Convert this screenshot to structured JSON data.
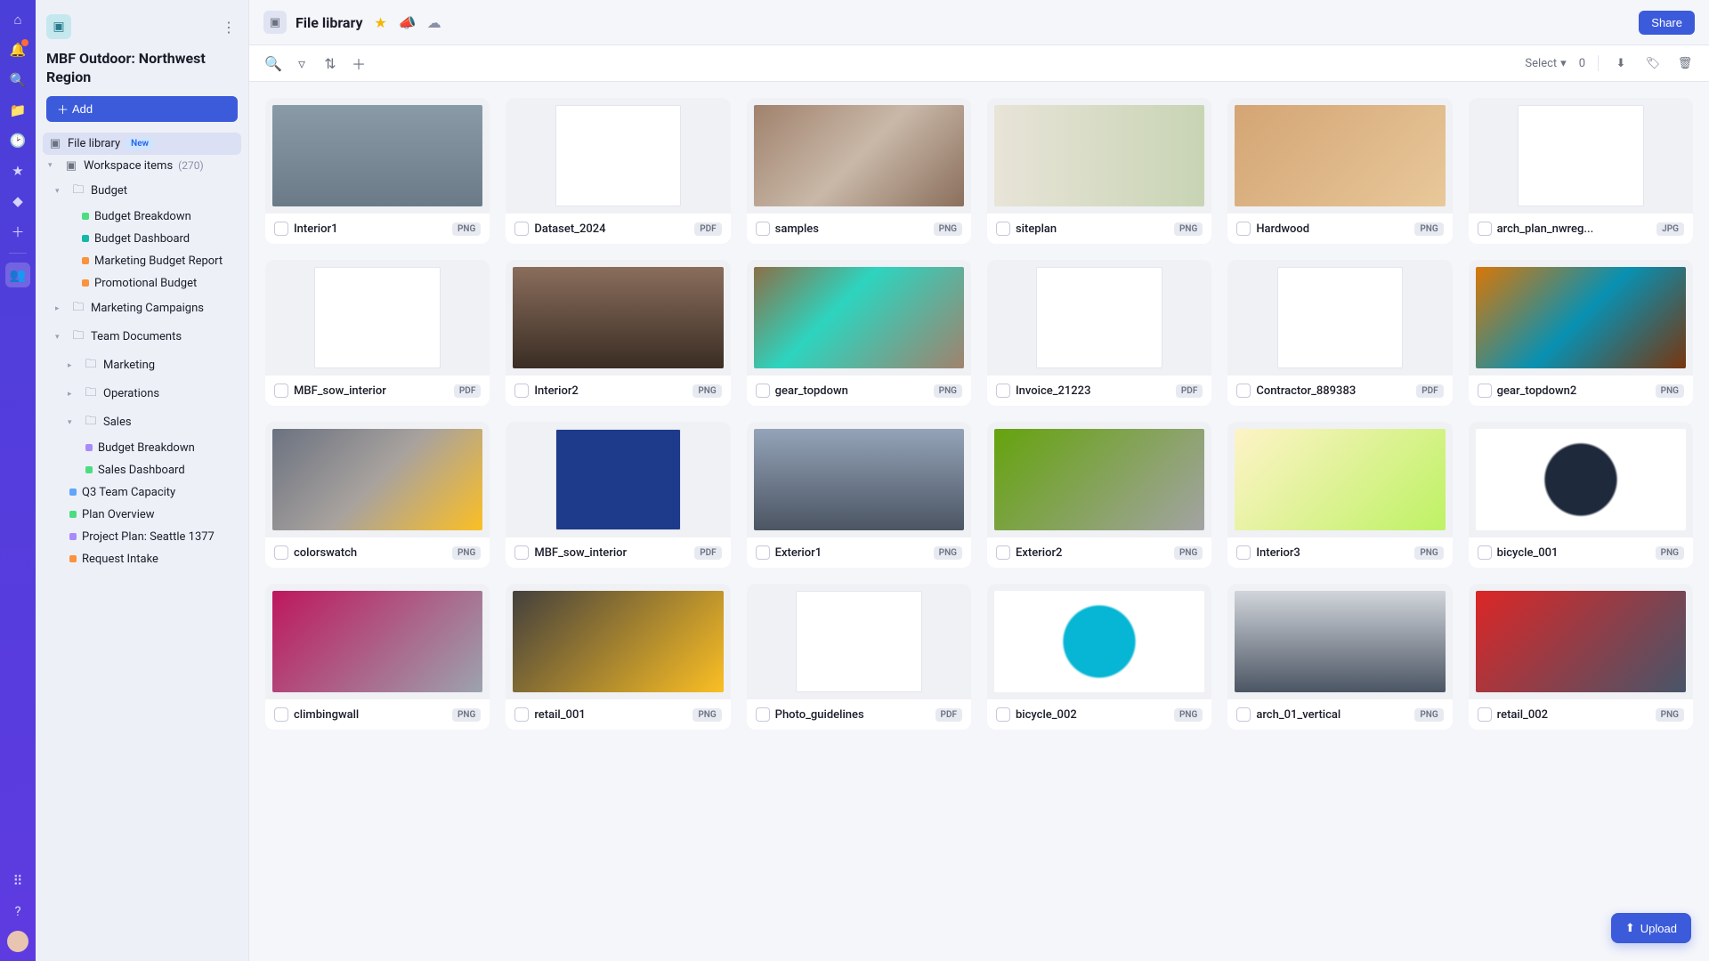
{
  "colors": {
    "green": "#4ade80",
    "teal": "#14b8a6",
    "orange": "#fb923c",
    "purple": "#a78bfa",
    "blue": "#60a5fa"
  },
  "rail": {
    "notification_count": 1
  },
  "sidebar": {
    "title": "MBF Outdoor: Northwest Region",
    "add_label": "Add",
    "file_library_label": "File library",
    "new_badge": "New",
    "workspace_items_label": "Workspace items",
    "workspace_items_count": "(270)",
    "tree": [
      {
        "label": "Budget",
        "type": "folder",
        "open": true,
        "children": [
          {
            "label": "Budget Breakdown",
            "color": "green"
          },
          {
            "label": "Budget Dashboard",
            "color": "teal"
          },
          {
            "label": "Marketing Budget Report",
            "color": "orange"
          },
          {
            "label": "Promotional Budget",
            "color": "orange"
          }
        ]
      },
      {
        "label": "Marketing Campaigns",
        "type": "folder",
        "open": false
      },
      {
        "label": "Team Documents",
        "type": "folder",
        "open": true,
        "children": [
          {
            "label": "Marketing",
            "type": "folder",
            "open": false
          },
          {
            "label": "Operations",
            "type": "folder",
            "open": false
          },
          {
            "label": "Sales",
            "type": "folder",
            "open": true,
            "children": [
              {
                "label": "Budget Breakdown",
                "color": "purple"
              },
              {
                "label": "Sales Dashboard",
                "color": "green"
              }
            ]
          }
        ]
      },
      {
        "label": "Q3 Team Capacity",
        "color": "blue"
      },
      {
        "label": "Plan Overview",
        "color": "green"
      },
      {
        "label": "Project Plan: Seattle 1377",
        "color": "purple"
      },
      {
        "label": "Request Intake",
        "color": "orange"
      }
    ]
  },
  "header": {
    "title": "File library",
    "share_label": "Share"
  },
  "toolbar": {
    "select_label": "Select",
    "count": "0",
    "upload_label": "Upload"
  },
  "files": [
    {
      "name": "Interior1",
      "type": "PNG",
      "kind": "img",
      "bg": "linear-gradient(180deg,#8a9ba8,#6b7a87)"
    },
    {
      "name": "Dataset_2024",
      "type": "PDF",
      "kind": "doc",
      "bg": "#fff"
    },
    {
      "name": "samples",
      "type": "PNG",
      "kind": "img",
      "bg": "linear-gradient(135deg,#a0826d,#c9b8a8,#8b6f5c)"
    },
    {
      "name": "siteplan",
      "type": "PNG",
      "kind": "img",
      "bg": "linear-gradient(90deg,#e8e4d8,#c8d4b4)"
    },
    {
      "name": "Hardwood",
      "type": "PNG",
      "kind": "img",
      "bg": "linear-gradient(135deg,#d4a574,#e8c89a)"
    },
    {
      "name": "arch_plan_nwreg...",
      "type": "JPG",
      "kind": "doc",
      "bg": "#fff"
    },
    {
      "name": "MBF_sow_interior",
      "type": "PDF",
      "kind": "doc",
      "bg": "#fff"
    },
    {
      "name": "Interior2",
      "type": "PNG",
      "kind": "img",
      "bg": "linear-gradient(180deg,#8a6d5c,#3a2d24)"
    },
    {
      "name": "gear_topdown",
      "type": "PNG",
      "kind": "img",
      "bg": "linear-gradient(135deg,#8b6f47,#2dd4bf 40%,#a0826d)"
    },
    {
      "name": "Invoice_21223",
      "type": "PDF",
      "kind": "doc",
      "bg": "#fff"
    },
    {
      "name": "Contractor_889383",
      "type": "PDF",
      "kind": "doc",
      "bg": "#fff"
    },
    {
      "name": "gear_topdown2",
      "type": "PNG",
      "kind": "img",
      "bg": "linear-gradient(135deg,#d97706,#0891b2,#78350f)"
    },
    {
      "name": "colorswatch",
      "type": "PNG",
      "kind": "img",
      "bg": "linear-gradient(135deg,#6b7280,#a8a29e,#fbbf24)"
    },
    {
      "name": "MBF_sow_interior",
      "type": "PDF",
      "kind": "doc",
      "bg": "#1e3a8a"
    },
    {
      "name": "Exterior1",
      "type": "PNG",
      "kind": "img",
      "bg": "linear-gradient(180deg,#94a3b8,#4b5563)"
    },
    {
      "name": "Exterior2",
      "type": "PNG",
      "kind": "img",
      "bg": "linear-gradient(135deg,#65a30d,#a3a3a3)"
    },
    {
      "name": "Interior3",
      "type": "PNG",
      "kind": "img",
      "bg": "linear-gradient(135deg,#fef3c7,#bef264)"
    },
    {
      "name": "bicycle_001",
      "type": "PNG",
      "kind": "img",
      "bg": "radial-gradient(circle,#1e293b 30%,#fff 32%)"
    },
    {
      "name": "climbingwall",
      "type": "PNG",
      "kind": "img",
      "bg": "linear-gradient(135deg,#be185d,#9ca3af)"
    },
    {
      "name": "retail_001",
      "type": "PNG",
      "kind": "img",
      "bg": "linear-gradient(135deg,#44403c,#fbbf24)"
    },
    {
      "name": "Photo_guidelines",
      "type": "PDF",
      "kind": "doc",
      "bg": "#fff"
    },
    {
      "name": "bicycle_002",
      "type": "PNG",
      "kind": "img",
      "bg": "radial-gradient(circle,#06b6d4 30%,#fff 32%)"
    },
    {
      "name": "arch_01_vertical",
      "type": "PNG",
      "kind": "img",
      "bg": "linear-gradient(180deg,#d1d5db,#4b5563)"
    },
    {
      "name": "retail_002",
      "type": "PNG",
      "kind": "img",
      "bg": "linear-gradient(135deg,#dc2626,#475569)"
    }
  ]
}
